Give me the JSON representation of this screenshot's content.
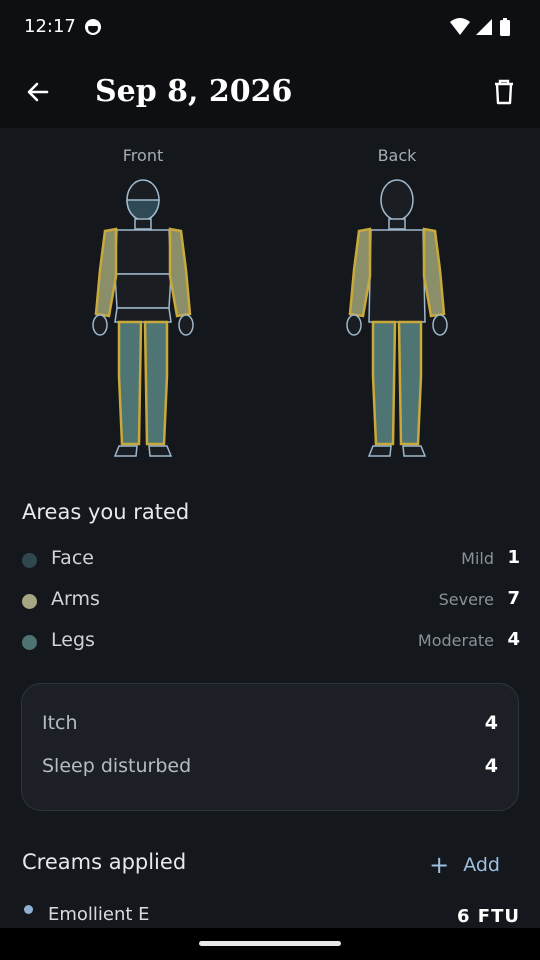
{
  "status_bar": {
    "time": "12:17",
    "icons": [
      "app-notification-icon",
      "wifi-icon",
      "signal-icon",
      "battery-icon"
    ]
  },
  "app_bar": {
    "title": "Sep 8, 2026",
    "back_icon": "arrow-left-icon",
    "delete_icon": "trash-icon"
  },
  "body_map": {
    "front_label": "Front",
    "back_label": "Back",
    "colors": {
      "outline": "#9fb8cc",
      "rated_outline": "#c9a93a",
      "face_fill": "#2f4a55",
      "arms_fill": "#8a8f6a",
      "legs_fill": "#4e7474",
      "torso_fill": "#1a1e23"
    }
  },
  "areas": {
    "title": "Areas you rated",
    "items": [
      {
        "name": "Face",
        "severity": "Mild",
        "score": "1",
        "color": "#31474f"
      },
      {
        "name": "Arms",
        "severity": "Severe",
        "score": "7",
        "color": "#a6a683"
      },
      {
        "name": "Legs",
        "severity": "Moderate",
        "score": "4",
        "color": "#4f7272"
      }
    ]
  },
  "metrics": [
    {
      "label": "Itch",
      "value": "4"
    },
    {
      "label": "Sleep disturbed",
      "value": "4"
    }
  ],
  "creams": {
    "title": "Creams applied",
    "add_label": "Add",
    "items": [
      {
        "name": "Emollient E",
        "amount": "6 FTU",
        "color": "#8fb0d0"
      }
    ]
  }
}
